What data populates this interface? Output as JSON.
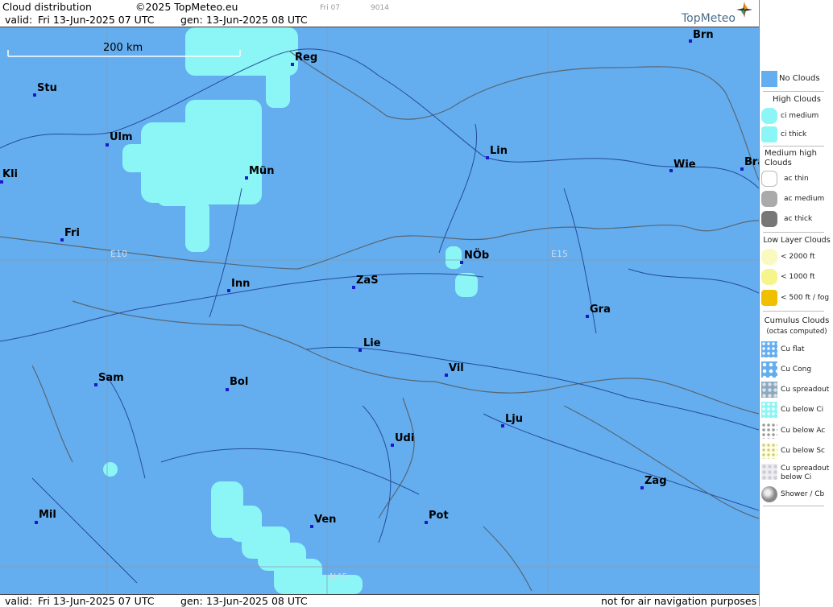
{
  "header": {
    "title": "Cloud distribution",
    "copyright": "©2025 TopMeteo.eu",
    "small_day": "Fri 07",
    "small_code": "9014",
    "valid_label": "valid:",
    "valid_value": "Fri  13-Jun-2025  07 UTC",
    "gen_label": "gen:",
    "gen_value": "13-Jun-2025 08 UTC",
    "logo": "TopMeteo"
  },
  "scale_bar": {
    "label": "200 km"
  },
  "grid_labels": {
    "lon1": "E10",
    "lon2": "E15",
    "lat1": "N45"
  },
  "cities": [
    {
      "name": "Brn"
    },
    {
      "name": "Reg"
    },
    {
      "name": "Stu"
    },
    {
      "name": "Ulm"
    },
    {
      "name": "Lin"
    },
    {
      "name": "Wie"
    },
    {
      "name": "Bra"
    },
    {
      "name": "Kli"
    },
    {
      "name": "Mün"
    },
    {
      "name": "Fri"
    },
    {
      "name": "NÖb"
    },
    {
      "name": "Inn"
    },
    {
      "name": "ZaS"
    },
    {
      "name": "Gra"
    },
    {
      "name": "Lie"
    },
    {
      "name": "Vil"
    },
    {
      "name": "Sam"
    },
    {
      "name": "Bol"
    },
    {
      "name": "Lju"
    },
    {
      "name": "Udi"
    },
    {
      "name": "Zag"
    },
    {
      "name": "Mil"
    },
    {
      "name": "Ven"
    },
    {
      "name": "Pot"
    }
  ],
  "footer": {
    "valid_label": "valid:",
    "valid_value": "Fri  13-Jun-2025  07 UTC",
    "gen_label": "gen:",
    "gen_value": "13-Jun-2025 08 UTC",
    "disclaimer": "not for air navigation purposes"
  },
  "legend": {
    "no_clouds": "No Clouds",
    "high_clouds": "High Clouds",
    "ci_medium": "ci medium",
    "ci_thick": "ci thick",
    "medium_high": "Medium high Clouds",
    "ac_thin": "ac thin",
    "ac_medium": "ac medium",
    "ac_thick": "ac thick",
    "low_layer": "Low Layer Clouds",
    "lt2000": "< 2000 ft",
    "lt1000": "< 1000 ft",
    "lt500": "< 500 ft / fog",
    "cumulus": "Cumulus Clouds",
    "octas": "(octas computed)",
    "cu_flat": "Cu flat",
    "cu_cong": "Cu Cong",
    "cu_spread": "Cu spreadout",
    "cu_below_ci": "Cu below Ci",
    "cu_below_ac": "Cu below Ac",
    "cu_below_sc": "Cu below Sc",
    "cu_spread_ci": "Cu spreadout below Ci",
    "shower": "Shower / Cb"
  },
  "colors": {
    "no_clouds": "#64aef0",
    "ci": "#8cf5f5",
    "ac_medium": "#aaaaaa",
    "ac_thick": "#777777",
    "low": "#f5f58c",
    "fog": "#f0c000"
  }
}
